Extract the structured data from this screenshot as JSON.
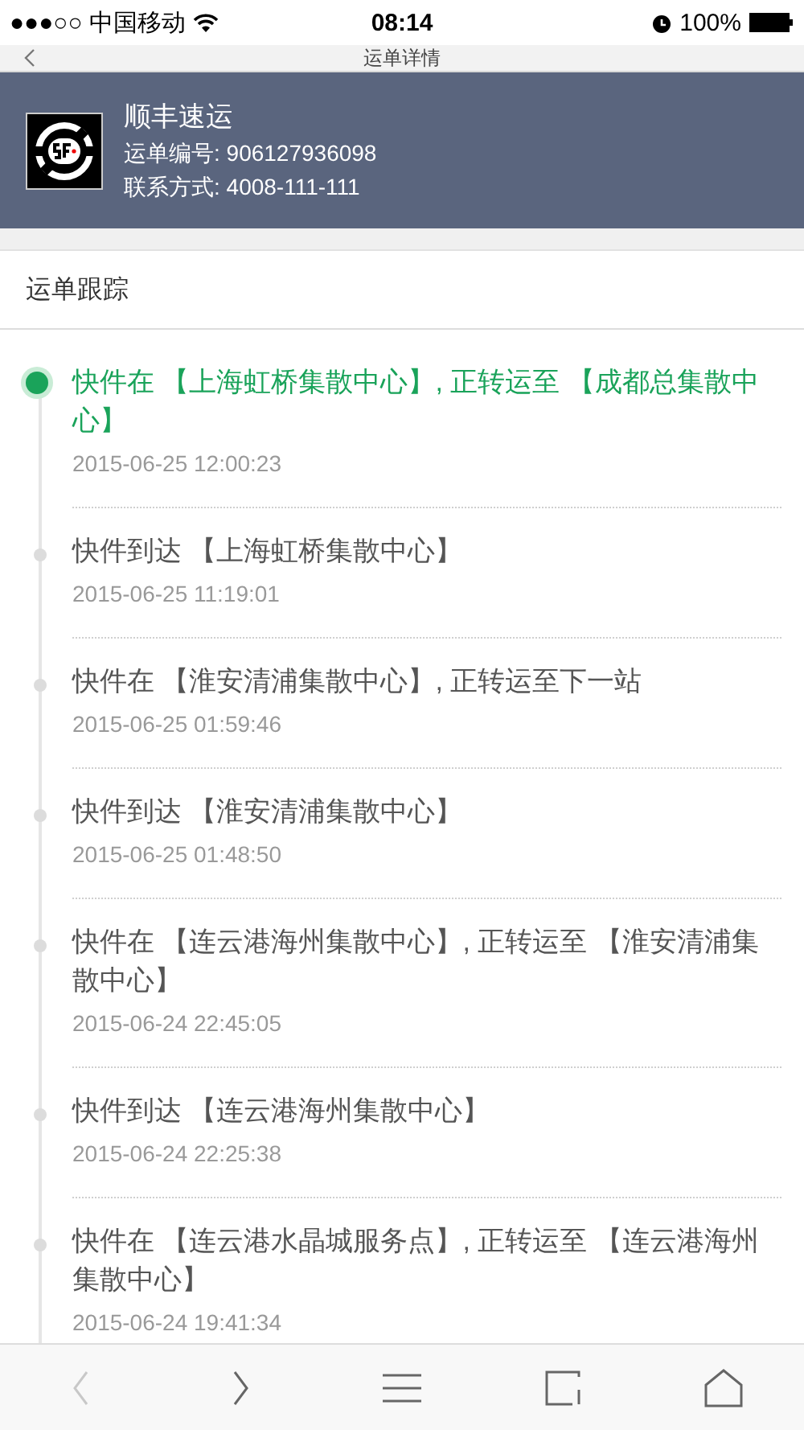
{
  "status_bar": {
    "carrier": "●●●○○ 中国移动",
    "time": "08:14",
    "battery": "100%"
  },
  "nav": {
    "title": "运单详情"
  },
  "courier": {
    "name": "顺丰速运",
    "tracking_number": "运单编号: 906127936098",
    "contact": "联系方式: 4008-111-111"
  },
  "section_title": "运单跟踪",
  "events": [
    {
      "text": "快件在 【上海虹桥集散中心】, 正转运至 【成都总集散中心】",
      "time": "2015-06-25 12:00:23",
      "latest": true
    },
    {
      "text": "快件到达 【上海虹桥集散中心】",
      "time": "2015-06-25 11:19:01",
      "latest": false
    },
    {
      "text": "快件在 【淮安清浦集散中心】, 正转运至下一站",
      "time": "2015-06-25 01:59:46",
      "latest": false
    },
    {
      "text": "快件到达 【淮安清浦集散中心】",
      "time": "2015-06-25 01:48:50",
      "latest": false
    },
    {
      "text": "快件在 【连云港海州集散中心】, 正转运至 【淮安清浦集散中心】",
      "time": "2015-06-24 22:45:05",
      "latest": false
    },
    {
      "text": "快件到达 【连云港海州集散中心】",
      "time": "2015-06-24 22:25:38",
      "latest": false
    },
    {
      "text": "快件在 【连云港水晶城服务点】, 正转运至 【连云港海州集散中心】",
      "time": "2015-06-24 19:41:34",
      "latest": false
    }
  ],
  "toolbar": [
    {
      "kind": "back",
      "disabled": true
    },
    {
      "kind": "forward",
      "disabled": false
    },
    {
      "kind": "menu",
      "disabled": false
    },
    {
      "kind": "tabs",
      "disabled": false
    },
    {
      "kind": "home",
      "disabled": false
    }
  ]
}
